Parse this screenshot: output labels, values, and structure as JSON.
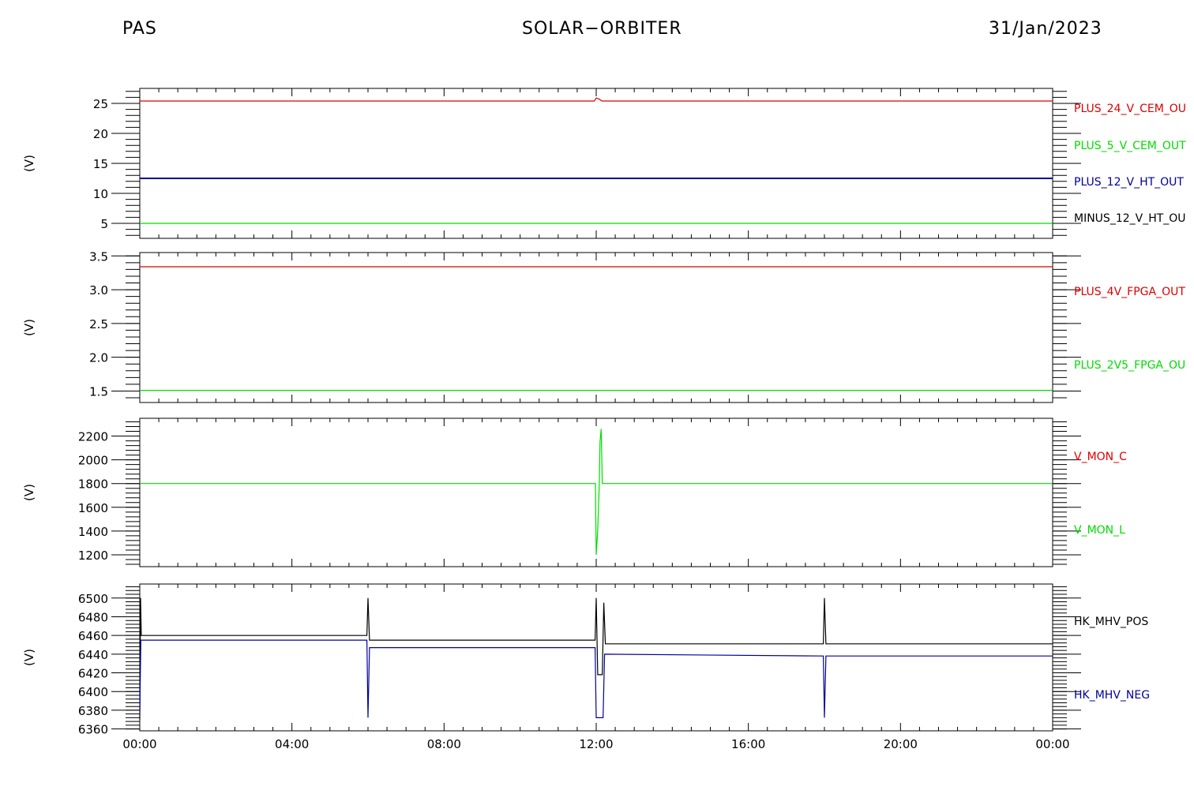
{
  "header": {
    "left": "PAS",
    "center": "SOLAR−ORBITER",
    "right": "31/Jan/2023"
  },
  "colors": {
    "red": "#dd0000",
    "green": "#00dd00",
    "blue": "#000099",
    "black": "#000000"
  },
  "chart_data": [
    {
      "type": "line",
      "ylabel": "(V)",
      "ylim": [
        2.5,
        27.5
      ],
      "yticks": [
        5,
        10,
        15,
        20,
        25
      ],
      "ytick_labels": [
        "5",
        "10",
        "15",
        "20",
        "25"
      ],
      "xlim": [
        0,
        24
      ],
      "series": [
        {
          "name": "PLUS_24_V_CEM_OU",
          "color": "#dd0000",
          "points": [
            [
              0,
              25.4
            ],
            [
              11.95,
              25.4
            ],
            [
              12.0,
              25.9
            ],
            [
              12.08,
              25.7
            ],
            [
              12.15,
              25.4
            ],
            [
              24,
              25.4
            ]
          ]
        },
        {
          "name": "PLUS_5_V_CEM_OUT",
          "color": "#00dd00",
          "points": [
            [
              0,
              5.0
            ],
            [
              24,
              5.0
            ]
          ]
        },
        {
          "name": "PLUS_12_V_HT_OUT",
          "color": "#000099",
          "width": 2,
          "points": [
            [
              0,
              12.5
            ],
            [
              24,
              12.5
            ]
          ]
        },
        {
          "name": "MINUS_12_V_HT_OU",
          "color": "#000000",
          "points": []
        }
      ]
    },
    {
      "type": "line",
      "ylabel": "(V)",
      "ylim": [
        1.33,
        3.55
      ],
      "yticks": [
        1.5,
        2.0,
        2.5,
        3.0,
        3.5
      ],
      "ytick_labels": [
        "1.5",
        "2.0",
        "2.5",
        "3.0",
        "3.5"
      ],
      "xlim": [
        0,
        24
      ],
      "series": [
        {
          "name": "PLUS_4V_FPGA_OUT",
          "color": "#dd0000",
          "points": [
            [
              0,
              3.34
            ],
            [
              24,
              3.34
            ]
          ]
        },
        {
          "name": "PLUS_2V5_FPGA_OU",
          "color": "#00dd00",
          "points": [
            [
              0,
              1.51
            ],
            [
              24,
              1.51
            ]
          ]
        }
      ]
    },
    {
      "type": "line",
      "ylabel": "(V)",
      "ylim": [
        1100,
        2350
      ],
      "yticks": [
        1200,
        1400,
        1600,
        1800,
        2000,
        2200
      ],
      "ytick_labels": [
        "1200",
        "1400",
        "1600",
        "1800",
        "2000",
        "2200"
      ],
      "xlim": [
        0,
        24
      ],
      "series": [
        {
          "name": "V_MON_C",
          "color": "#dd0000",
          "points": []
        },
        {
          "name": "V_MON_L",
          "color": "#00dd00",
          "points": [
            [
              0,
              1800
            ],
            [
              11.98,
              1800
            ],
            [
              12.0,
              1200
            ],
            [
              12.04,
              1400
            ],
            [
              12.08,
              1800
            ],
            [
              12.1,
              2150
            ],
            [
              12.13,
              2260
            ],
            [
              12.16,
              1800
            ],
            [
              24,
              1800
            ]
          ]
        }
      ]
    },
    {
      "type": "line",
      "ylabel": "(V)",
      "ylim": [
        6358,
        6515
      ],
      "yticks": [
        6360,
        6380,
        6400,
        6420,
        6440,
        6460,
        6480,
        6500
      ],
      "ytick_labels": [
        "6360",
        "6380",
        "6400",
        "6420",
        "6440",
        "6460",
        "6480",
        "6500"
      ],
      "xlim": [
        0,
        24
      ],
      "xticks": [
        0,
        4,
        8,
        12,
        16,
        20,
        24
      ],
      "xtick_labels": [
        "00:00",
        "04:00",
        "08:00",
        "12:00",
        "16:00",
        "20:00",
        "00:00"
      ],
      "series": [
        {
          "name": "HK_MHV_POS",
          "color": "#000000",
          "points": [
            [
              0,
              6370
            ],
            [
              0.02,
              6500
            ],
            [
              0.04,
              6460
            ],
            [
              5.97,
              6460
            ],
            [
              6.0,
              6500
            ],
            [
              6.04,
              6455
            ],
            [
              11.97,
              6455
            ],
            [
              12.0,
              6500
            ],
            [
              12.04,
              6418
            ],
            [
              12.16,
              6418
            ],
            [
              12.2,
              6495
            ],
            [
              12.24,
              6451
            ],
            [
              17.97,
              6451
            ],
            [
              18.0,
              6500
            ],
            [
              18.04,
              6451
            ],
            [
              24,
              6451
            ]
          ]
        },
        {
          "name": "HK_MHV_NEG",
          "color": "#000099",
          "points": [
            [
              0,
              6380
            ],
            [
              0.03,
              6455
            ],
            [
              5.97,
              6455
            ],
            [
              6.0,
              6372
            ],
            [
              6.04,
              6447
            ],
            [
              11.97,
              6447
            ],
            [
              12.0,
              6372
            ],
            [
              12.18,
              6372
            ],
            [
              12.22,
              6440
            ],
            [
              17.97,
              6438
            ],
            [
              18.0,
              6372
            ],
            [
              18.04,
              6438
            ],
            [
              24,
              6438
            ]
          ]
        }
      ]
    }
  ]
}
